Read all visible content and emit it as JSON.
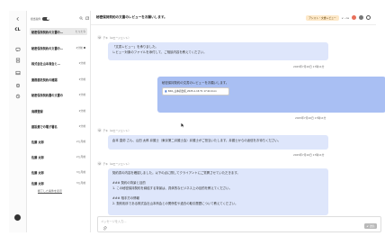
{
  "rail": {
    "logo": "CL",
    "icons": [
      "collapse-icon",
      "chat-icon",
      "document-icon",
      "inbox-icon",
      "settings-icon",
      "history-icon"
    ]
  },
  "sidebar": {
    "filter_label": "担当案件",
    "threads": [
      {
        "title": "秘密保持契約の文書のレビュー",
        "time": "たった今",
        "active": true,
        "unread": false
      },
      {
        "title": "秘密保持契約の文書のレ...",
        "time": "2分前",
        "active": false,
        "unread": true
      },
      {
        "title": "株式会社山本商会と...",
        "time": "2分前",
        "active": false,
        "unread": false
      },
      {
        "title": "業務委託契約の確認",
        "time": "2分前",
        "active": false,
        "unread": false
      },
      {
        "title": "秘密保持契約書の文書の",
        "time": "2分前",
        "active": false,
        "unread": false
      },
      {
        "title": "商標登録",
        "time": "2分前",
        "active": false,
        "unread": false
      },
      {
        "title": "建設業での電子署名",
        "time": "2分前",
        "active": false,
        "unread": false
      },
      {
        "title": "佐藤 太郎",
        "time": "2ヵ月前",
        "active": false,
        "unread": false
      },
      {
        "title": "佐藤 太郎",
        "time": "2ヵ月前",
        "active": false,
        "unread": false
      },
      {
        "title": "佐藤 太郎",
        "time": "3ヵ月前",
        "active": false,
        "unread": false
      },
      {
        "title": "佐藤 太郎",
        "time": "3ヵ月前",
        "active": false,
        "unread": false
      }
    ],
    "more_label": "終了した案件を表示"
  },
  "topbar": {
    "title": "秘密保持契約の文書のレビューをお願いします。",
    "badge": "アシスト・文書レビュー",
    "version": "v - ce"
  },
  "messages": [
    {
      "role": "ai",
      "sender": "テキ（AIエージェント）",
      "lines": [
        "「文書レビュー」を承りました。",
        "レビュー対象のファイルを添付して、ご相談内容を教えてください。"
      ],
      "time": "2025年7月16日 17時11分"
    },
    {
      "role": "user",
      "lines": [
        "秘密保持契約の文書のレビューをお願いします。"
      ],
      "attachment": "NDA_山本商会様_2025-1-16 T1 17:42.docx",
      "time": "2025年7月16日 17時11分"
    },
    {
      "role": "ai",
      "sender": "テキ（AIエージェント）",
      "lines": [
        "倉本 直弥 さん、山田 太郎 弁護士（東京第二弁護士会）弁護士がご担当いたします。弁護士からの返信をお待ちください。"
      ],
      "time": "2025年7月16日 17時11分"
    },
    {
      "role": "ai",
      "sender": "テキ（AIエージェント）",
      "lines": [
        "契約書の内容を確認しました。以下の点に関してクライアントにご質問させていただきます。",
        "",
        "### 契約の背景と目的",
        "1. この秘密保持契約を締結する背景は、具体的なビジネス上の目的を教えてください。",
        "",
        "### 相手方の情報",
        "2. 契約相手である株式会社山本商会との関係性や過去の取引履歴について教えてください。"
      ]
    }
  ],
  "composer": {
    "placeholder": "メッセージを入力...",
    "send_label": "送信"
  }
}
